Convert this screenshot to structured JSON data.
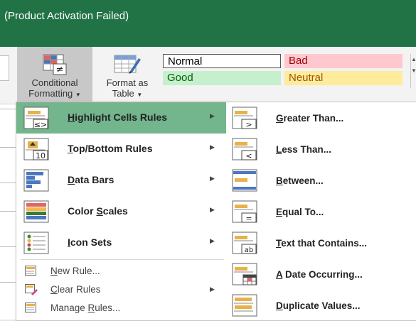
{
  "window": {
    "title": "(Product Activation Failed)"
  },
  "ribbon": {
    "conditional_formatting": {
      "line1": "Conditional",
      "line2": "Formatting"
    },
    "format_as_table": {
      "line1": "Format as",
      "line2": "Table"
    },
    "cell_styles": {
      "normal": "Normal",
      "bad": "Bad",
      "good": "Good",
      "neutral": "Neutral"
    }
  },
  "menu": {
    "items": [
      {
        "pre": "",
        "accel": "H",
        "post": "ighlight Cells Rules",
        "icon": "highlight-cells-icon",
        "highlighted": true
      },
      {
        "pre": "",
        "accel": "T",
        "post": "op/Bottom Rules",
        "icon": "top-bottom-icon"
      },
      {
        "pre": "",
        "accel": "D",
        "post": "ata Bars",
        "icon": "data-bars-icon"
      },
      {
        "pre": "Color ",
        "accel": "S",
        "post": "cales",
        "icon": "color-scales-icon"
      },
      {
        "pre": "",
        "accel": "I",
        "post": "con Sets",
        "icon": "icon-sets-icon"
      }
    ],
    "small_items": [
      {
        "pre": "",
        "accel": "N",
        "post": "ew Rule...",
        "icon": "new-rule-icon"
      },
      {
        "pre": "",
        "accel": "C",
        "post": "lear Rules",
        "icon": "clear-rules-icon"
      },
      {
        "pre": "Manage ",
        "accel": "R",
        "post": "ules...",
        "icon": "manage-rules-icon"
      }
    ]
  },
  "submenu": {
    "items": [
      {
        "pre": "",
        "accel": "G",
        "post": "reater Than...",
        "icon": "greater-than-icon"
      },
      {
        "pre": "",
        "accel": "L",
        "post": "ess Than...",
        "icon": "less-than-icon"
      },
      {
        "pre": "",
        "accel": "B",
        "post": "etween...",
        "icon": "between-icon"
      },
      {
        "pre": "",
        "accel": "E",
        "post": "qual To...",
        "icon": "equal-to-icon"
      },
      {
        "pre": "",
        "accel": "T",
        "post": "ext that Contains...",
        "icon": "text-contains-icon"
      },
      {
        "pre": "",
        "accel": "A",
        "post": " Date Occurring...",
        "icon": "date-occurring-icon"
      },
      {
        "pre": "",
        "accel": "D",
        "post": "uplicate Values...",
        "icon": "duplicate-values-icon"
      }
    ]
  },
  "colors": {
    "title_bar": "#217346",
    "highlight": "#73b58c"
  }
}
